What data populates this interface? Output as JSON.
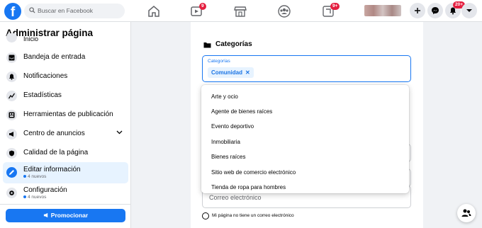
{
  "header": {
    "logo": "f",
    "search_placeholder": "Buscar en Facebook",
    "nav": [
      {
        "name": "home-icon"
      },
      {
        "name": "watch-icon",
        "badge": "9"
      },
      {
        "name": "marketplace-icon"
      },
      {
        "name": "groups-icon"
      },
      {
        "name": "gaming-icon",
        "badge": "9+"
      }
    ],
    "actions": [
      {
        "name": "create-icon"
      },
      {
        "name": "messenger-icon"
      },
      {
        "name": "notifications-icon",
        "badge": "20+"
      },
      {
        "name": "account-menu-icon"
      }
    ]
  },
  "sidebar": {
    "title": "Administrar página",
    "items": [
      {
        "label": "Inicio",
        "icon": "home-icon"
      },
      {
        "label": "Bandeja de entrada",
        "icon": "inbox-icon"
      },
      {
        "label": "Notificaciones",
        "icon": "bell-icon"
      },
      {
        "label": "Estadísticas",
        "icon": "stats-icon"
      },
      {
        "label": "Herramientas de publicación",
        "icon": "publishing-tools-icon"
      },
      {
        "label": "Centro de anuncios",
        "icon": "megaphone-icon"
      },
      {
        "label": "Calidad de la página",
        "icon": "shield-icon"
      },
      {
        "label": "Editar información",
        "sub": "4 nuevos",
        "icon": "pencil-icon"
      },
      {
        "label": "Configuración",
        "sub": "4 nuevos",
        "icon": "gear-icon"
      }
    ],
    "promote_label": "Promocionar"
  },
  "main": {
    "section_title": "Categorías",
    "field_label": "Categorías",
    "chip": "Comunidad",
    "dropdown_options": [
      "Arte y ocio",
      "Agente de bienes raíces",
      "Evento deportivo",
      "Inmobiliaria",
      "Bienes raíces",
      "Sitio web de comercio electrónico",
      "Tienda de ropa para hombres"
    ],
    "email_placeholder": "Correo electrónico",
    "no_email_label": "Mi página no tiene un correo electrónico"
  },
  "colors": {
    "brand": "#1877f2",
    "badge": "#e41e3f",
    "active_bg": "#e7f3ff"
  }
}
